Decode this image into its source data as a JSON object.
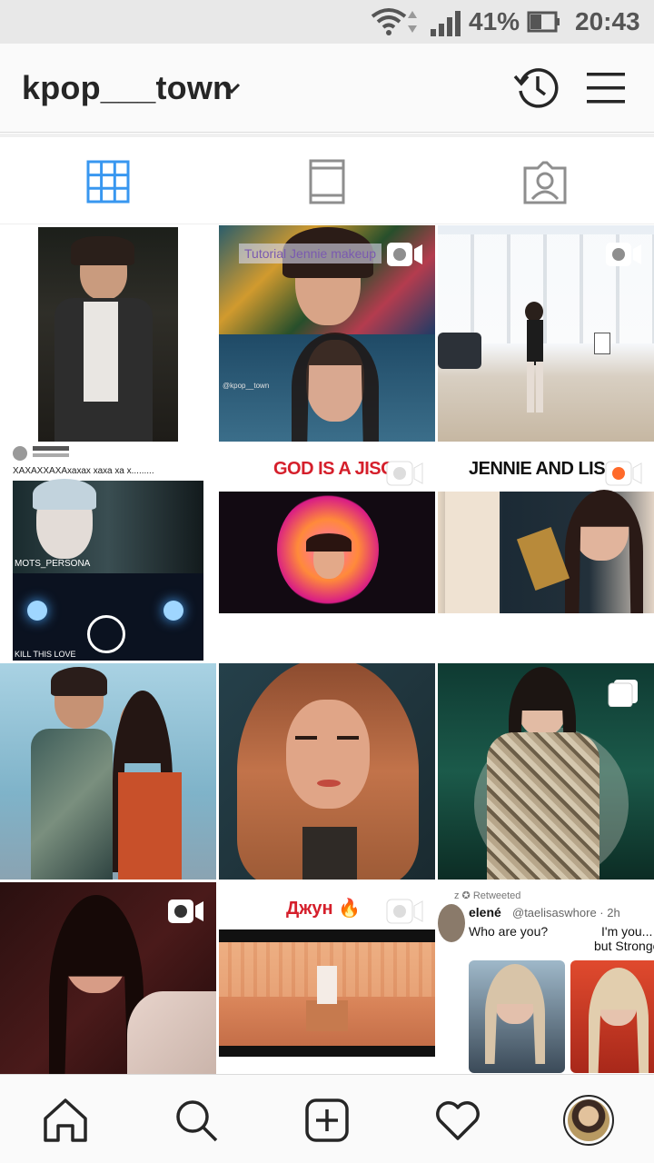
{
  "status_bar": {
    "battery": "41%",
    "time": "20:43"
  },
  "header": {
    "username": "kpop___town",
    "icons": [
      "chevron-down-icon",
      "archive-clock-icon",
      "hamburger-menu-icon"
    ]
  },
  "tabs": [
    {
      "name": "grid",
      "icon": "grid-icon",
      "active": true
    },
    {
      "name": "igtv",
      "icon": "igtv-icon",
      "active": false
    },
    {
      "name": "tagged",
      "icon": "tagged-user-icon",
      "active": false
    }
  ],
  "posts": [
    {
      "caption": "",
      "type": "photo"
    },
    {
      "caption": "Tutorial Jennie makeup",
      "type": "video",
      "watermark": "@kpop__town"
    },
    {
      "caption": "",
      "type": "video"
    },
    {
      "caption": "XAXAXXAXAхахах хаха ха х.........",
      "type": "photo",
      "subtext": "MOTS_PERSONA",
      "footer": "KILL THIS LOVE"
    },
    {
      "caption": "GOD IS A JISOO",
      "type": "video"
    },
    {
      "caption": "JENNIE AND LISA",
      "type": "video"
    },
    {
      "caption": "",
      "type": "photo"
    },
    {
      "caption": "",
      "type": "photo"
    },
    {
      "caption": "",
      "type": "carousel"
    },
    {
      "caption": "",
      "type": "video"
    },
    {
      "caption": "Джун 🔥",
      "type": "video"
    },
    {
      "caption": "",
      "type": "photo",
      "tweet": {
        "retweeted": "z ✪ Retweeted",
        "name": "elené",
        "handle": "@taelisaswhore · 2h",
        "text": "Who are you?",
        "reply": "I'm you...",
        "reply2": "but Stronge"
      }
    }
  ],
  "bottom_nav": [
    {
      "name": "home",
      "icon": "home-icon"
    },
    {
      "name": "search",
      "icon": "search-icon"
    },
    {
      "name": "new-post",
      "icon": "add-post-icon"
    },
    {
      "name": "activity",
      "icon": "heart-icon"
    },
    {
      "name": "profile",
      "icon": "profile-avatar-icon"
    }
  ],
  "colors": {
    "accent": "#3897f0",
    "icon": "#262626",
    "inactive_icon": "#8e8e8e"
  }
}
